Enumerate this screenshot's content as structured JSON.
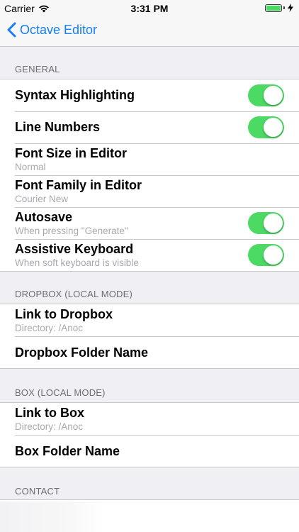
{
  "status_bar": {
    "carrier": "Carrier",
    "time": "3:31 PM"
  },
  "nav": {
    "back_label": "Octave Editor"
  },
  "sections": {
    "general": {
      "header": "GENERAL",
      "rows": [
        {
          "title": "Syntax Highlighting",
          "toggle": true
        },
        {
          "title": "Line Numbers",
          "toggle": true
        },
        {
          "title": "Font Size in Editor",
          "subtitle": "Normal"
        },
        {
          "title": "Font Family in Editor",
          "subtitle": "Courier New"
        },
        {
          "title": "Autosave",
          "subtitle": "When pressing \"Generate\"",
          "toggle": true
        },
        {
          "title": "Assistive Keyboard",
          "subtitle": "When soft keyboard is visible",
          "toggle": true
        }
      ]
    },
    "dropbox": {
      "header": "DROPBOX (LOCAL MODE)",
      "rows": [
        {
          "title": "Link to Dropbox",
          "subtitle": "Directory: /Anoc"
        },
        {
          "title": "Dropbox Folder Name"
        }
      ]
    },
    "box": {
      "header": "BOX (LOCAL MODE)",
      "rows": [
        {
          "title": "Link to Box",
          "subtitle": "Directory: /Anoc"
        },
        {
          "title": "Box Folder Name"
        }
      ]
    },
    "contact": {
      "header": "CONTACT"
    }
  },
  "colors": {
    "accent": "#157efb",
    "toggle_on": "#4cd964",
    "background": "#efeff4"
  }
}
